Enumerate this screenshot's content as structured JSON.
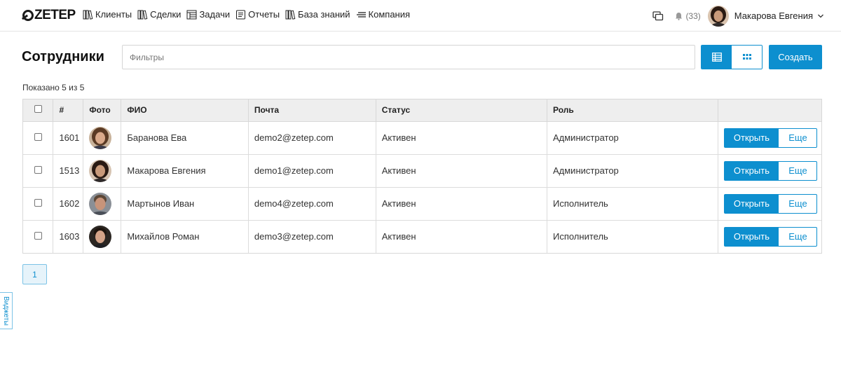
{
  "header": {
    "logo_text": "ZETEP",
    "nav": [
      {
        "label": "Клиенты",
        "icon": "book-icon"
      },
      {
        "label": "Сделки",
        "icon": "book-icon"
      },
      {
        "label": "Задачи",
        "icon": "table-icon"
      },
      {
        "label": "Отчеты",
        "icon": "document-icon"
      },
      {
        "label": "База знаний",
        "icon": "book-icon"
      },
      {
        "label": "Компания",
        "icon": "menu-lines-icon"
      }
    ],
    "notifications_count": "(33)",
    "user_name": "Макарова Евгения"
  },
  "page": {
    "title": "Сотрудники",
    "filter_placeholder": "Фильтры",
    "create_label": "Создать",
    "shown_text": "Показано 5 из 5"
  },
  "table": {
    "columns": [
      "#",
      "Фото",
      "ФИО",
      "Почта",
      "Статус",
      "Роль"
    ],
    "rows": [
      {
        "id": "1601",
        "name": "Баранова Ева",
        "email": "demo2@zetep.com",
        "status": "Активен",
        "role": "Администратор"
      },
      {
        "id": "1513",
        "name": "Макарова Евгения",
        "email": "demo1@zetep.com",
        "status": "Активен",
        "role": "Администратор"
      },
      {
        "id": "1602",
        "name": "Мартынов Иван",
        "email": "demo4@zetep.com",
        "status": "Активен",
        "role": "Исполнитель"
      },
      {
        "id": "1603",
        "name": "Михайлов Роман",
        "email": "demo3@zetep.com",
        "status": "Активен",
        "role": "Исполнитель"
      }
    ],
    "open_label": "Открыть",
    "more_label": "Еще"
  },
  "pagination": {
    "current": "1"
  },
  "widgets_label": "Виджеты",
  "colors": {
    "accent": "#0d8fcf"
  }
}
